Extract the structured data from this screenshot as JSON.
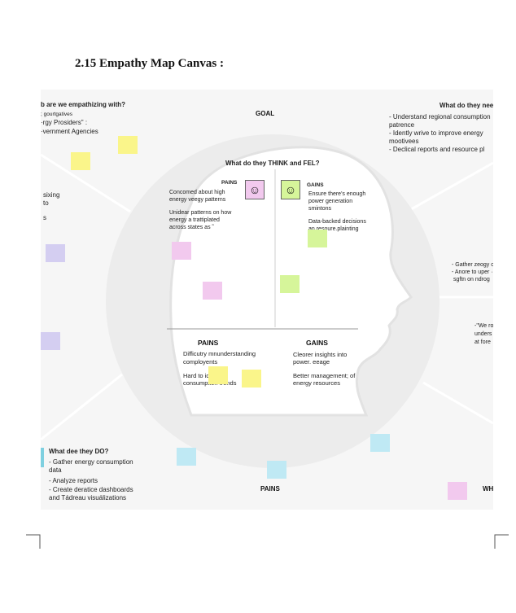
{
  "heading": "2.15  Empathy Map Canvas :",
  "who": {
    "title": "b are we empathizing with?",
    "lines": [
      "; gourtgatives",
      "·rgy Prosiders\"    :",
      "·vernment Agencies"
    ]
  },
  "goal": "GOAL",
  "need": {
    "title": "What do they need",
    "lines": [
      "- Understand regional consumption",
      "patrence",
      "- Idently wrive to improve energy",
      "mootivees",
      "- Declical reports and resource pl"
    ]
  },
  "left_mid": [
    "sixing",
    "to",
    "s"
  ],
  "think_feel": {
    "title": "What do they THINK and FEL?",
    "pains_label": "PAINS",
    "pains_lines": [
      "Concomed about high",
      "energy veegy patterns",
      "",
      "Unidear patterns on how",
      "energy a trattiplated",
      "across states as    ˜"
    ],
    "gains_label": "GAINS",
    "gains_lines": [
      "Ensure there's enough",
      "power generation",
      "smintons",
      "",
      "Data-backed decisions",
      "an resoure.plainting"
    ],
    "face_icon": "☺"
  },
  "right_mid": {
    "lines1": [
      "- Gather zeogy o",
      "- Anore to uper ·",
      "sgftn on ndrog"
    ],
    "lines2": [
      "-\"We ro",
      "unders",
      "at fore"
    ]
  },
  "pains_gains": {
    "pains_label": "PAINS",
    "pains_lines": [
      "Difficutry mnunderstanding",
      "comployents",
      "",
      "Hard to identify",
      "consumption trends"
    ],
    "gains_label": "GAINS",
    "gains_lines": [
      "Cleorer insights into",
      "power. eeage",
      "",
      "Better management; of",
      "energy resources"
    ]
  },
  "do": {
    "title": "What dee they DO?",
    "lines": [
      "- Gather energy consumption",
      "   data",
      "- Analyze reports",
      "- Create deratice dashboards",
      "   and Tádreau visuálizations"
    ]
  },
  "bottom_pains": "PAINS",
  "bottom_right": "WH",
  "colors": {
    "yellow": "#faf58a",
    "green": "#d6f59a",
    "pink": "#f2c9ee",
    "violet": "#d4cef1",
    "cyan": "#bfe9f4"
  }
}
